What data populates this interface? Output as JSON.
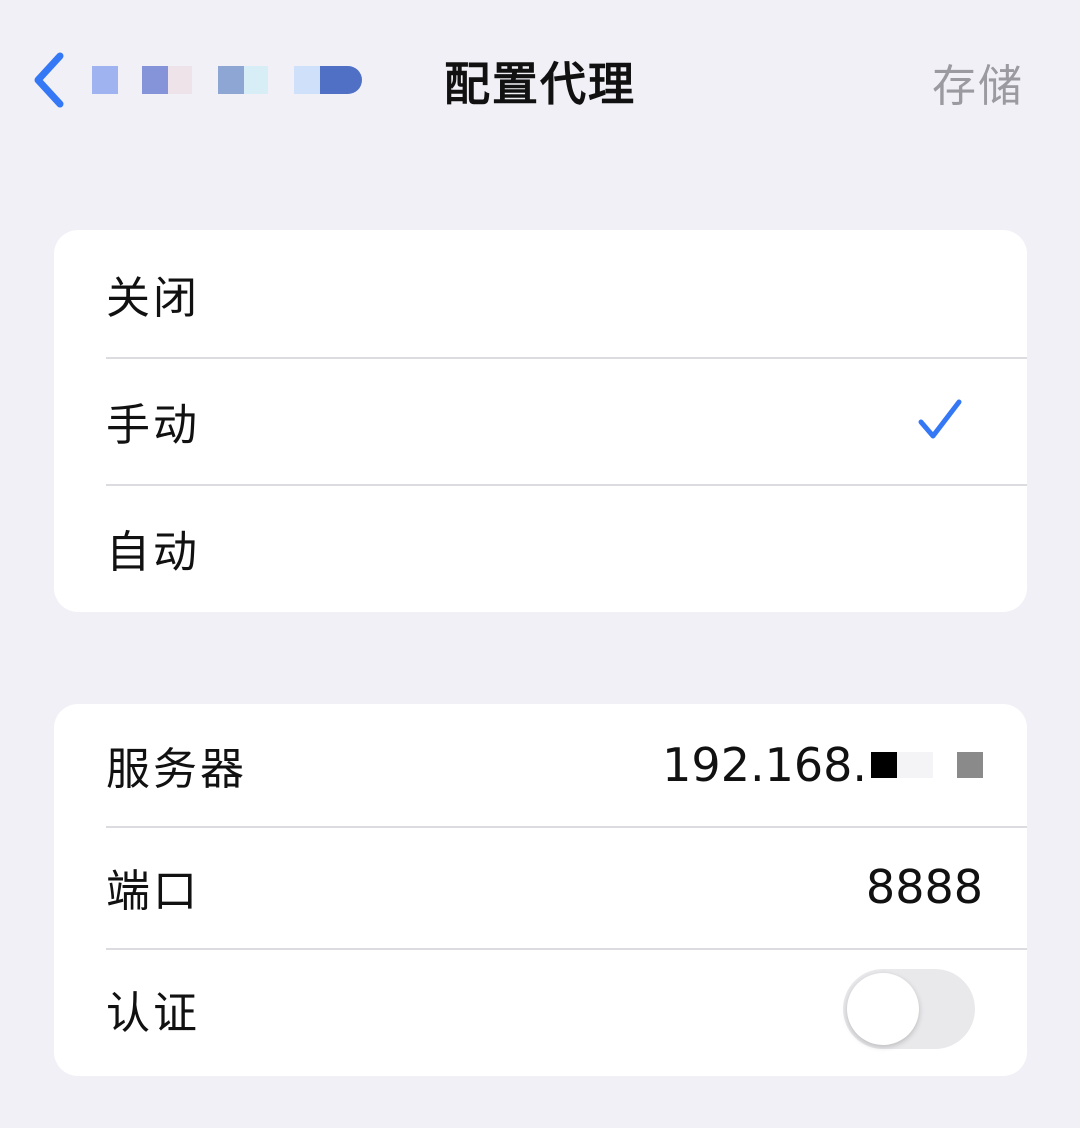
{
  "nav": {
    "title": "配置代理",
    "save_label": "存储",
    "back_label": ""
  },
  "mode_options": [
    {
      "label": "关闭",
      "selected": false
    },
    {
      "label": "手动",
      "selected": true
    },
    {
      "label": "自动",
      "selected": false
    }
  ],
  "proxy": {
    "server_label": "服务器",
    "server_value": "192.168.",
    "port_label": "端口",
    "port_value": "8888",
    "auth_label": "认证",
    "auth_enabled": false
  },
  "colors": {
    "accent": "#3478f6",
    "background": "#f1f0f6",
    "disabled_text": "#9a9aa0",
    "separator": "#dcdce0"
  }
}
